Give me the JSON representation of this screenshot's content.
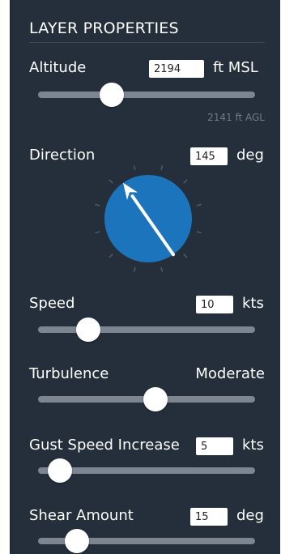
{
  "panel": {
    "title": "LAYER PROPERTIES"
  },
  "altitude": {
    "label": "Altitude",
    "value": "2194",
    "unit": "ft MSL",
    "agl": "2141 ft AGL",
    "slider_fraction": 0.34
  },
  "direction": {
    "label": "Direction",
    "value": "145",
    "unit": "deg",
    "heading_deg": 145
  },
  "speed": {
    "label": "Speed",
    "value": "10",
    "unit": "kts",
    "slider_fraction": 0.23
  },
  "turbulence": {
    "label": "Turbulence",
    "level": "Moderate",
    "slider_fraction": 0.54
  },
  "gust": {
    "label": "Gust Speed Increase",
    "value": "5",
    "unit": "kts",
    "slider_fraction": 0.1
  },
  "shear": {
    "label": "Shear Amount",
    "value": "15",
    "unit": "deg",
    "slider_fraction": 0.18
  },
  "colors": {
    "panel_bg": "#252f3b",
    "dial_fill": "#1c75bc",
    "track": "#7c8590",
    "thumb": "#ffffff"
  }
}
